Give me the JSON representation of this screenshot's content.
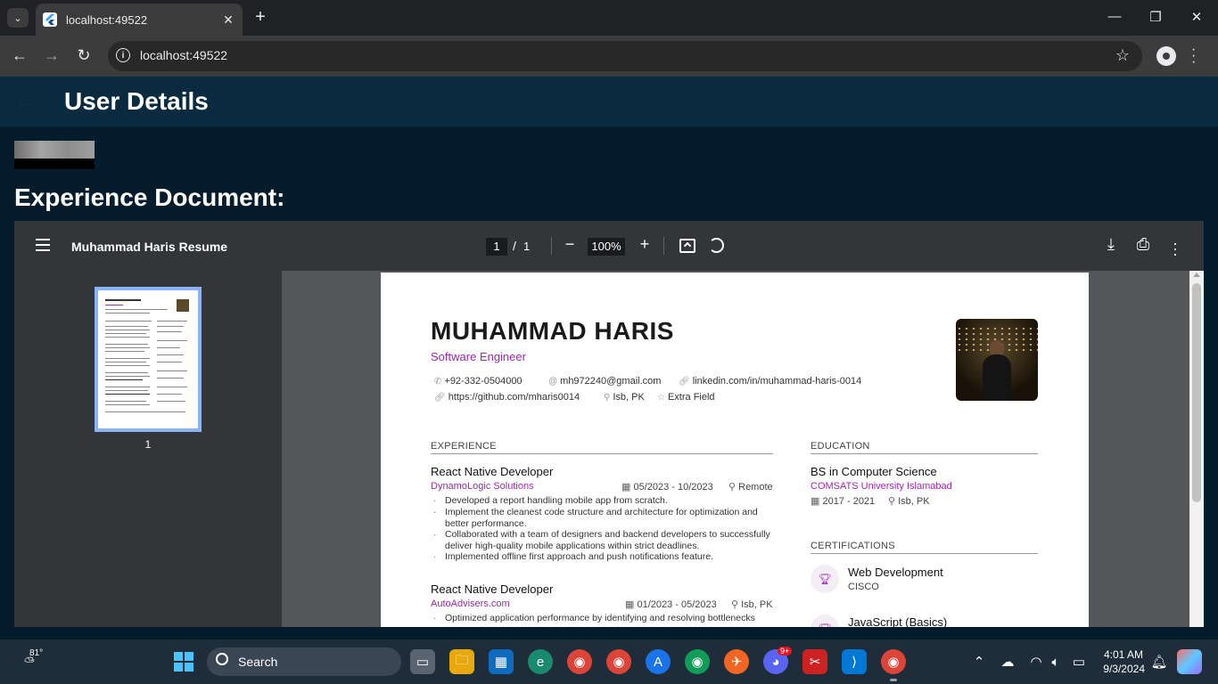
{
  "browser": {
    "tab_title": "localhost:49522",
    "url": "localhost:49522"
  },
  "app": {
    "title": "User Details",
    "section_title": "Experience Document:"
  },
  "pdf_viewer": {
    "file_title": "Muhammad Haris Resume",
    "current_page": "1",
    "page_separator": "/",
    "total_pages": "1",
    "zoom": "100%",
    "thumbnail_label": "1"
  },
  "resume": {
    "name": "MUHAMMAD HARIS",
    "role": "Software Engineer",
    "phone": "+92-332-0504000",
    "email": "mh972240@gmail.com",
    "linkedin": "linkedin.com/in/muhammad-haris-0014",
    "github": "https://github.com/mharis0014",
    "location": "Isb, PK",
    "extra": "Extra Field",
    "experience_heading": "EXPERIENCE",
    "education_heading": "EDUCATION",
    "certifications_heading": "CERTIFICATIONS",
    "jobs": [
      {
        "title": "React Native Developer",
        "company": "DynamoLogic Solutions",
        "dates": "05/2023 - 10/2023",
        "location": "Remote",
        "bullets": [
          "Developed a report handling mobile app from scratch.",
          "Implement the cleanest code structure and architecture for optimization and better performance.",
          "Collaborated with a team of designers and backend developers to successfully deliver high-quality mobile applications within strict deadlines.",
          "Implemented offline first approach and push notifications feature."
        ]
      },
      {
        "title": "React Native Developer",
        "company": "AutoAdvisers.com",
        "dates": "01/2023 - 05/2023",
        "location": "Isb, PK",
        "bullets": [
          "Optimized application performance by identifying and resolving bottlenecks"
        ]
      }
    ],
    "education": {
      "degree": "BS in Computer Science",
      "school": "COMSATS University Islamabad",
      "dates": "2017 - 2021",
      "location": "Isb, PK"
    },
    "certifications": [
      {
        "name": "Web Development",
        "issuer": "CISCO"
      },
      {
        "name": "JavaScript (Basics)",
        "issuer": ""
      }
    ]
  },
  "taskbar": {
    "weather_temp": "81°",
    "search_label": "Search",
    "time": "4:01 AM",
    "date": "9/3/2024",
    "discord_badge": "9+"
  },
  "colors": {
    "app_bg": "#041c2c",
    "appbar_bg": "#0a2a3f",
    "accent_purple": "#9c27b0"
  }
}
